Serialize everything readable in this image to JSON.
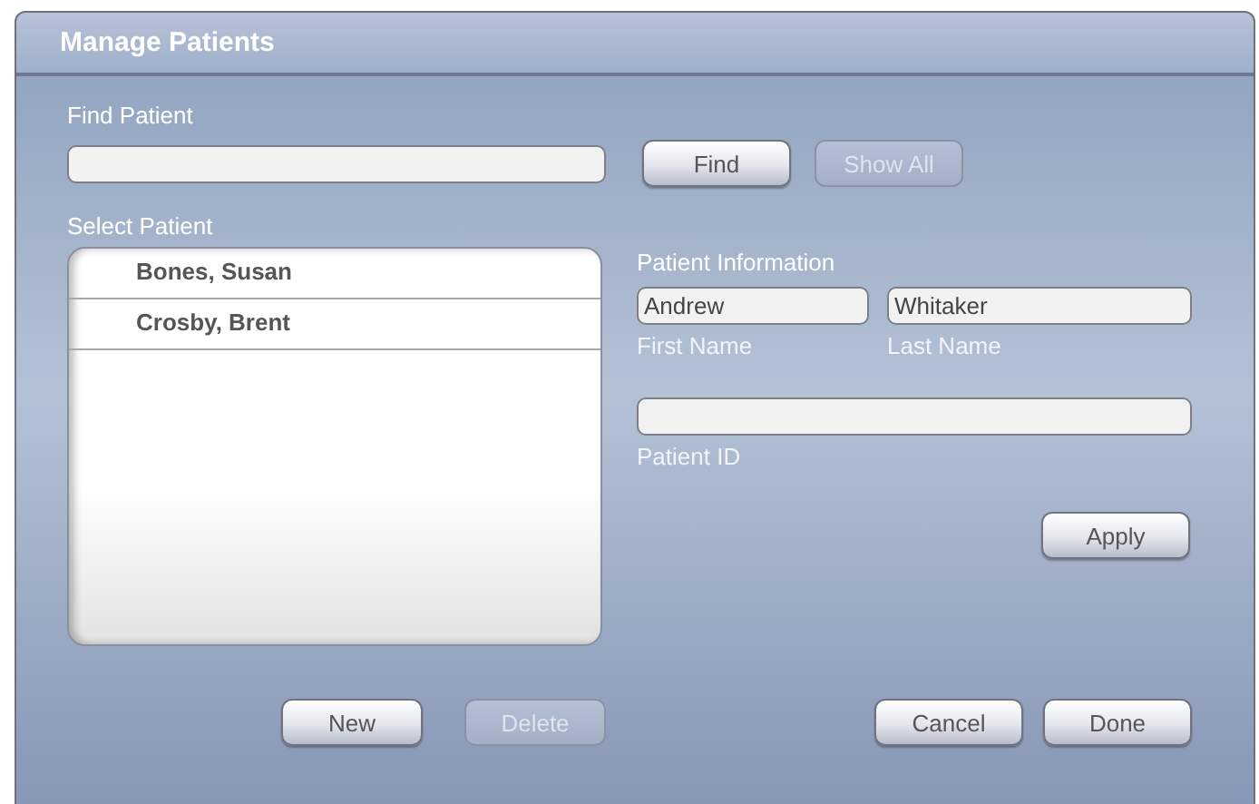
{
  "window": {
    "title": "Manage Patients"
  },
  "find": {
    "label": "Find Patient",
    "buttons": [
      {
        "label": "Find",
        "disabled": false
      },
      {
        "label": "Show All",
        "disabled": true
      }
    ]
  },
  "select": {
    "label": "Select Patient",
    "patients": [
      {
        "name": "Bones, Susan",
        "selected": false
      },
      {
        "name": "Crosby, Brent",
        "selected": false
      }
    ]
  },
  "info": {
    "title": "Patient Information",
    "first_name": {
      "value": "Andrew",
      "label": "First Name"
    },
    "last_name": {
      "value": "Whitaker",
      "label": "Last Name"
    },
    "patient_id": {
      "label": "Patient ID"
    },
    "apply": {
      "label": "Apply",
      "disabled": false
    }
  },
  "list_buttons": [
    {
      "label": "New",
      "disabled": false
    },
    {
      "label": "Delete",
      "disabled": true
    }
  ],
  "dialog_buttons": [
    {
      "label": "Cancel",
      "disabled": false
    },
    {
      "label": "Done",
      "disabled": false
    }
  ]
}
